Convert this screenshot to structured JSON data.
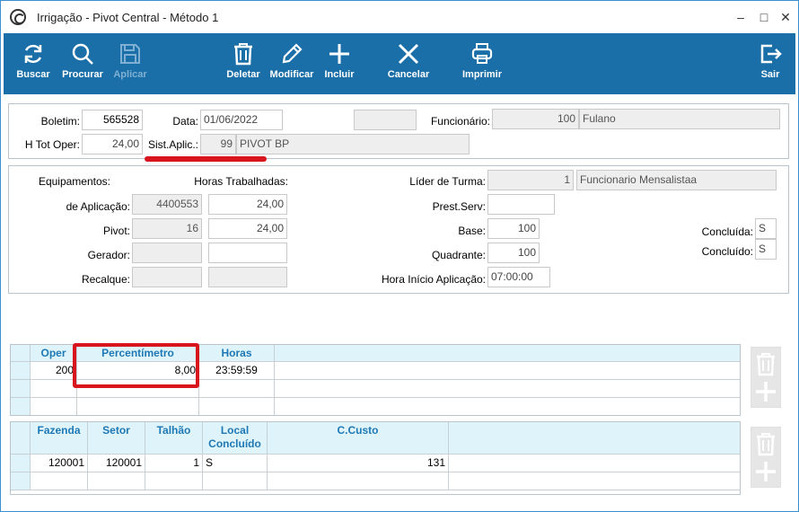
{
  "window": {
    "title": "Irrigação - Pivot Central - Método 1"
  },
  "toolbar": {
    "buscar": "Buscar",
    "procurar": "Procurar",
    "aplicar": "Aplicar",
    "deletar": "Deletar",
    "modificar": "Modificar",
    "incluir": "Incluir",
    "cancelar": "Cancelar",
    "imprimir": "Imprimir",
    "sair": "Sair",
    "accent": "#1a6fa8"
  },
  "header": {
    "boletim_label": "Boletim:",
    "boletim": "565528",
    "data_label": "Data:",
    "data": "01/06/2022",
    "blank_field": "",
    "funcionario_label": "Funcionário:",
    "funcionario_code": "100",
    "funcionario_name": "Fulano",
    "htot_label": "H Tot Oper:",
    "htot": "24,00",
    "sist_label": "Sist.Aplic.:",
    "sist_code": "99",
    "sist_name": "PIVOT BP"
  },
  "details": {
    "equip_label": "Equipamentos:",
    "horas_label": "Horas Trabalhadas:",
    "aplic_label": "de Aplicação:",
    "aplic_val": "4400553",
    "aplic_horas": "24,00",
    "pivot_label": "Pivot:",
    "pivot_val": "16",
    "pivot_horas": "24,00",
    "gerador_label": "Gerador:",
    "recalque_label": "Recalque:",
    "lider_label": "Líder de Turma:",
    "lider_code": "1",
    "lider_name": "Funcionario Mensalistaa",
    "prest_label": "Prest.Serv:",
    "base_label": "Base:",
    "base_val": "100",
    "quadrante_label": "Quadrante:",
    "quadrante_val": "100",
    "hora_inicio_label": "Hora Início Aplicação:",
    "hora_inicio_val": "07:00:00",
    "concluida_label": "Concluída:",
    "concluida_val": "S",
    "concluido_label": "Concluído:",
    "concluido_val": "S"
  },
  "grid1": {
    "headers": [
      "Oper",
      "Percentímetro",
      "Horas"
    ],
    "rows": [
      [
        "200",
        "8,00",
        "23:59:59"
      ]
    ]
  },
  "grid2": {
    "headers": [
      "Fazenda",
      "Setor",
      "Talhão",
      "Local Concluído",
      "C.Custo"
    ],
    "rows": [
      [
        "120001",
        "120001",
        "1",
        "S",
        "131"
      ]
    ]
  }
}
